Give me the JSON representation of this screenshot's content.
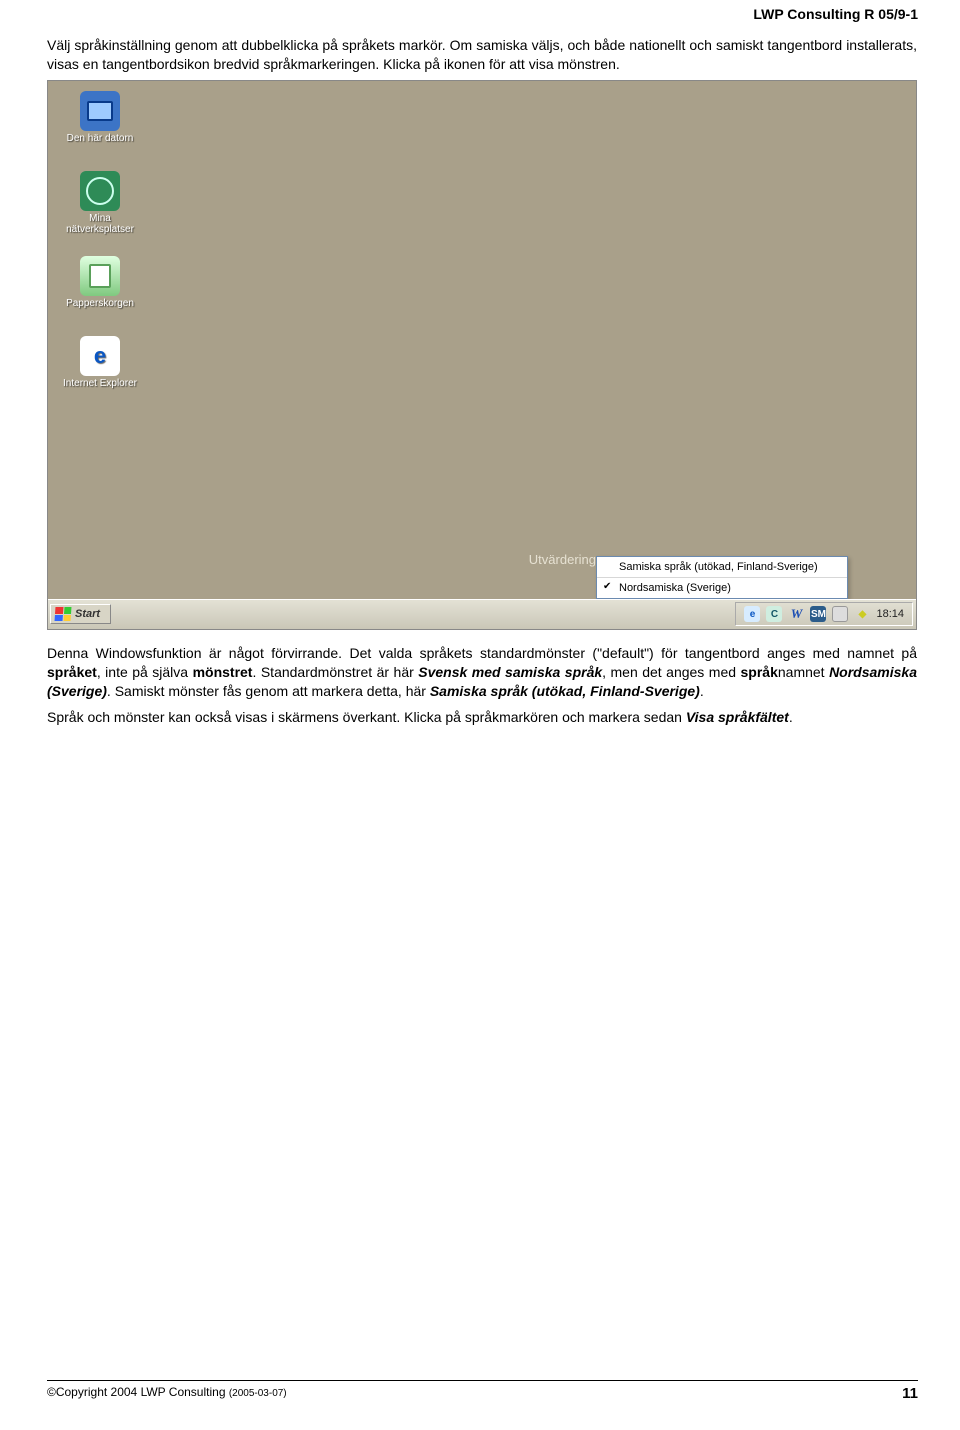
{
  "doc": {
    "header": "LWP Consulting R 05/9-1",
    "intro": "Välj språkinställning genom att dubbelklicka på språkets markör. Om samiska väljs, och både nationellt och samiskt tangentbord installerats, visas en tangentbordsikon bredvid språkmarkeringen. Klicka på ikonen för att visa mönstren.",
    "p2a": "Denna Windowsfunktion är något förvirrande. Det valda språkets standardmönster (\"default\") för tangentbord anges med namnet på ",
    "p2b": "språket",
    "p2c": ", inte på själva ",
    "p2d": "mönstret",
    "p2e": ". Standardmönstret är här ",
    "p2f": "Svensk med samiska språk",
    "p2g": ", men det anges med ",
    "p2h": "språk",
    "p2i": "namnet ",
    "p2j": "Nordsamiska (Sverige)",
    "p2k": ". Samiskt mönster fås genom att markera detta, här ",
    "p2l": "Samiska språk (utökad, Finland-Sverige)",
    "p2m": ".",
    "p3a": "Språk och mönster kan också visas i skärmens överkant. Klicka på språkmarkören och markera sedan ",
    "p3b": "Visa språkfältet",
    "p3c": ".",
    "footer_left": "©Copyright 2004 LWP Consulting ",
    "footer_sub": "(2005-03-07)",
    "page_number": "11"
  },
  "screenshot": {
    "icons": {
      "computer": "Den här datorn",
      "network": "Mina nätverksplatser",
      "recycle": "Papperskorgen",
      "ie": "Internet Explorer"
    },
    "utvardering": "Utvärdering",
    "popup": {
      "item1": "Samiska språk (utökad, Finland-Sverige)",
      "item2": "Nordsamiska (Sverige)"
    },
    "start": "Start",
    "tray": {
      "ie": "e",
      "c": "C",
      "w": "W",
      "sm": "SM"
    },
    "clock": "18:14"
  }
}
